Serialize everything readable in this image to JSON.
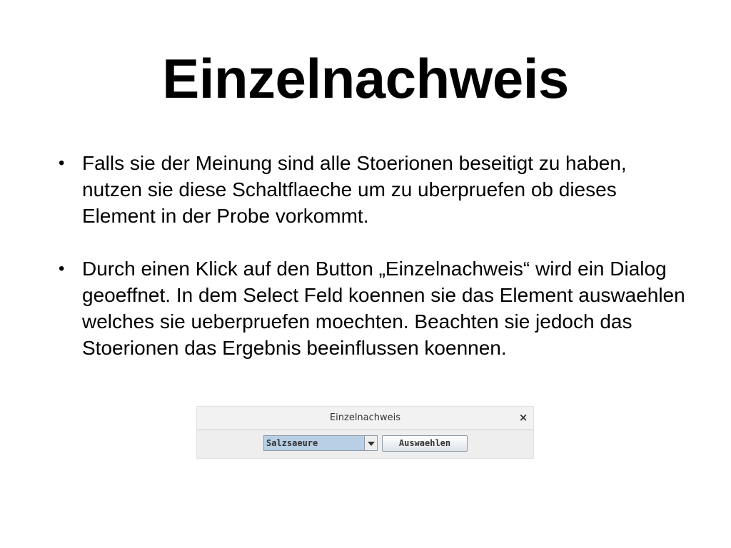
{
  "slide": {
    "title": "Einzelnachweis",
    "bullets": [
      {
        "marker": "•",
        "text": "Falls sie der Meinung sind alle Stoerionen beseitigt zu haben, nutzen sie diese Schaltflaeche um zu uberpruefen ob dieses Element in der Probe vorkommt."
      },
      {
        "marker": "•",
        "text": "Durch einen Klick auf den Button „Einzelnachweis“ wird ein Dialog geoeffnet. In dem Select Feld koennen sie das Element auswaehlen welches sie ueberpruefen moechten. Beachten sie jedoch das Stoerionen das Ergebnis beeinflussen koennen."
      }
    ]
  },
  "dialog": {
    "title": "Einzelnachweis",
    "close_glyph": "×",
    "select": {
      "selected_value": "Salzsaeure"
    },
    "button_label": "Auswaehlen"
  },
  "colors": {
    "background": "#ffffff",
    "dialog_background": "#eeeeee",
    "select_highlight": "#b8cfe5"
  },
  "icons": {
    "close": "close-icon",
    "dropdown": "chevron-down-icon"
  }
}
